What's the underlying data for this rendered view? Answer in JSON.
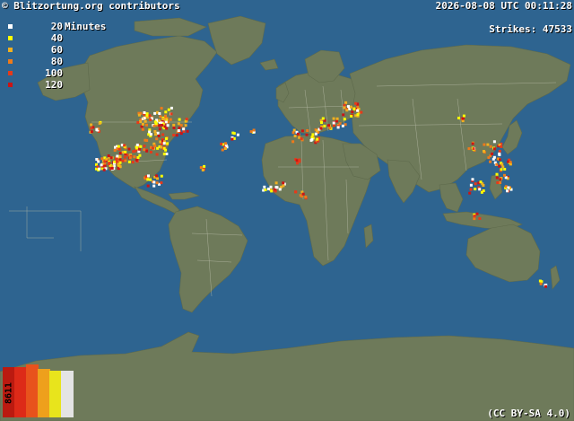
{
  "header": {
    "credit": "© Blitzortung.org contributors",
    "datetime": "2026-08-08 UTC 00:11:28",
    "strikes_label": "Strikes: 47533"
  },
  "legend": {
    "items": [
      {
        "label": "20",
        "unit": "Minutes",
        "color": "#ffffff"
      },
      {
        "label": "40",
        "unit": "",
        "color": "#ffff00"
      },
      {
        "label": "60",
        "unit": "",
        "color": "#f0b020"
      },
      {
        "label": "80",
        "unit": "",
        "color": "#ee7a1a"
      },
      {
        "label": "100",
        "unit": "",
        "color": "#e63a1a"
      },
      {
        "label": "120",
        "unit": "",
        "color": "#cc1414"
      }
    ]
  },
  "histogram": {
    "count_label": "8611",
    "bars": [
      {
        "level": 0.93,
        "color": "#bb1a10"
      },
      {
        "level": 0.93,
        "color": "#dd2a18"
      },
      {
        "level": 0.98,
        "color": "#e8521c"
      },
      {
        "level": 0.9,
        "color": "#eea01c"
      },
      {
        "level": 0.87,
        "color": "#e8e41c"
      },
      {
        "level": 0.87,
        "color": "#e4e4e4"
      }
    ]
  },
  "footer": {
    "license": "(CC BY-SA 4.0)"
  },
  "colors": {
    "ocean": "#2e6490",
    "land": "#6e7a5a",
    "borders": "#b8bca8"
  }
}
